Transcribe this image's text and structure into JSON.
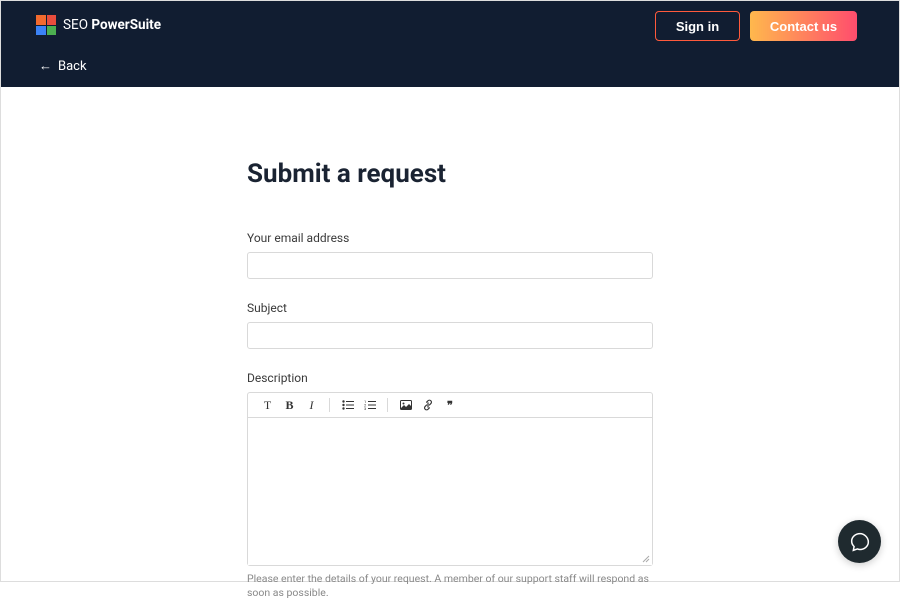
{
  "header": {
    "brand_prefix": "SEO ",
    "brand_bold": "PowerSuite",
    "signin_label": "Sign in",
    "contact_label": "Contact us",
    "back_label": "Back"
  },
  "form": {
    "title": "Submit a request",
    "email_label": "Your email address",
    "subject_label": "Subject",
    "description_label": "Description",
    "hint": "Please enter the details of your request. A member of our support staff will respond as soon as possible."
  },
  "toolbar": {
    "paragraph_label": "T",
    "bold_label": "B",
    "italic_label": "I",
    "bullet_label": "•",
    "number_label": "1.",
    "image_label": "img",
    "link_label": "link",
    "quote_label": "quote"
  }
}
